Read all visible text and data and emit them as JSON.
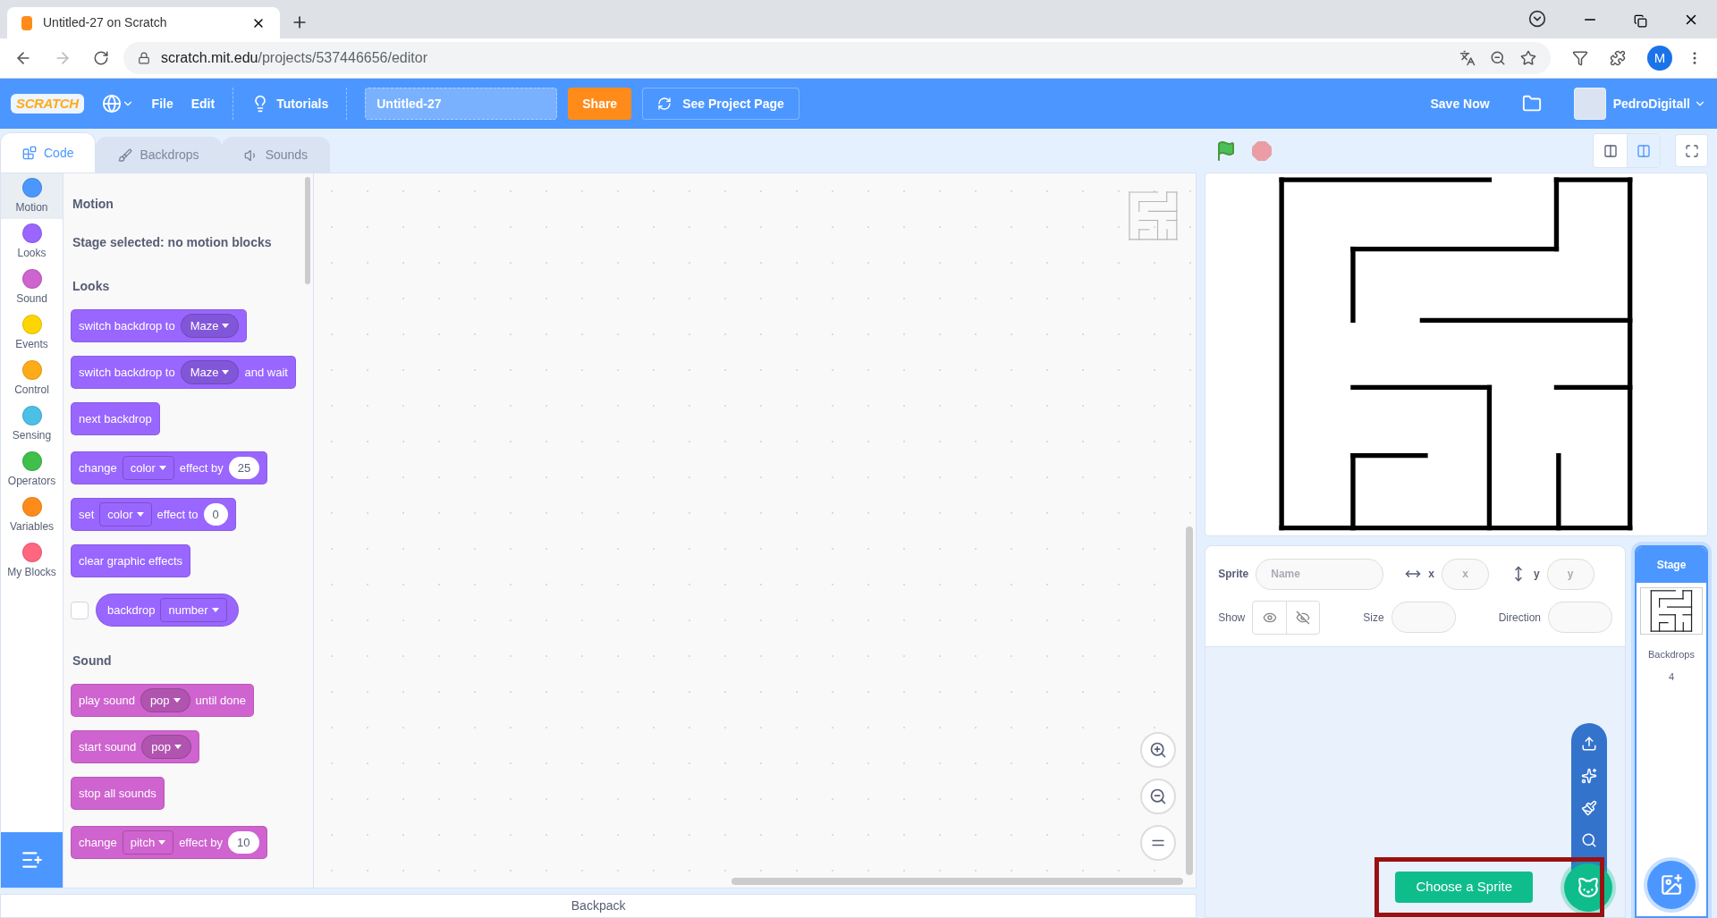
{
  "browser": {
    "tab_title": "Untitled-27 on Scratch",
    "url_host": "scratch.mit.edu",
    "url_path": "/projects/537446656/editor",
    "profile_letter": "M"
  },
  "menubar": {
    "logo": "SCRATCH",
    "items": [
      "File",
      "Edit"
    ],
    "tutorials": "Tutorials",
    "project_title": "Untitled-27",
    "share": "Share",
    "see_project": "See Project Page",
    "save_now": "Save Now",
    "username": "PedroDigitall"
  },
  "editor_tabs": [
    {
      "label": "Code",
      "selected": true
    },
    {
      "label": "Backdrops",
      "selected": false
    },
    {
      "label": "Sounds",
      "selected": false
    }
  ],
  "categories": [
    {
      "label": "Motion",
      "color": "#4c97ff",
      "selected": true
    },
    {
      "label": "Looks",
      "color": "#9966ff",
      "selected": false
    },
    {
      "label": "Sound",
      "color": "#cf63cf",
      "selected": false
    },
    {
      "label": "Events",
      "color": "#ffd500",
      "selected": false
    },
    {
      "label": "Control",
      "color": "#ffab19",
      "selected": false
    },
    {
      "label": "Sensing",
      "color": "#4cbfe6",
      "selected": false
    },
    {
      "label": "Operators",
      "color": "#40bf4a",
      "selected": false
    },
    {
      "label": "Variables",
      "color": "#ff8c1a",
      "selected": false
    },
    {
      "label": "My Blocks",
      "color": "#ff6680",
      "selected": false
    }
  ],
  "palette": [
    {
      "title": "Motion",
      "note": "Stage selected: no motion blocks"
    },
    {
      "title": "Looks",
      "groups": [
        [
          {
            "kind": "stack",
            "color": "#9966ff",
            "parts": [
              {
                "kind": "text",
                "text": "switch backdrop to"
              },
              {
                "kind": "menu",
                "text": "Maze"
              }
            ]
          },
          {
            "kind": "stack",
            "color": "#9966ff",
            "parts": [
              {
                "kind": "text",
                "text": "switch backdrop to"
              },
              {
                "kind": "menu",
                "text": "Maze"
              },
              {
                "kind": "text",
                "text": "and wait"
              }
            ]
          },
          {
            "kind": "stack",
            "color": "#9966ff",
            "parts": [
              {
                "kind": "text",
                "text": "next backdrop"
              }
            ]
          }
        ],
        [
          {
            "kind": "stack",
            "color": "#9966ff",
            "parts": [
              {
                "kind": "text",
                "text": "change"
              },
              {
                "kind": "field",
                "text": "color"
              },
              {
                "kind": "text",
                "text": "effect by"
              },
              {
                "kind": "number",
                "text": "25"
              }
            ]
          },
          {
            "kind": "stack",
            "color": "#9966ff",
            "parts": [
              {
                "kind": "text",
                "text": "set"
              },
              {
                "kind": "field",
                "text": "color"
              },
              {
                "kind": "text",
                "text": "effect to"
              },
              {
                "kind": "number",
                "text": "0"
              }
            ]
          },
          {
            "kind": "stack",
            "color": "#9966ff",
            "parts": [
              {
                "kind": "text",
                "text": "clear graphic effects"
              }
            ]
          }
        ],
        [
          {
            "kind": "reporter",
            "color": "#9966ff",
            "checked": false,
            "parts": [
              {
                "kind": "text",
                "text": "backdrop"
              },
              {
                "kind": "field",
                "text": "number"
              }
            ]
          }
        ]
      ]
    },
    {
      "title": "Sound",
      "groups": [
        [
          {
            "kind": "stack",
            "color": "#cf63cf",
            "parts": [
              {
                "kind": "text",
                "text": "play sound"
              },
              {
                "kind": "menu",
                "text": "pop"
              },
              {
                "kind": "text",
                "text": "until done"
              }
            ]
          },
          {
            "kind": "stack",
            "color": "#cf63cf",
            "parts": [
              {
                "kind": "text",
                "text": "start sound"
              },
              {
                "kind": "menu",
                "text": "pop"
              }
            ]
          },
          {
            "kind": "stack",
            "color": "#cf63cf",
            "parts": [
              {
                "kind": "text",
                "text": "stop all sounds"
              }
            ]
          }
        ],
        [
          {
            "kind": "stack",
            "color": "#cf63cf",
            "parts": [
              {
                "kind": "text",
                "text": "change"
              },
              {
                "kind": "field",
                "text": "pitch"
              },
              {
                "kind": "text",
                "text": "effect by"
              },
              {
                "kind": "number",
                "text": "10"
              }
            ]
          }
        ]
      ]
    }
  ],
  "sprite_info": {
    "sprite_label": "Sprite",
    "name_placeholder": "Name",
    "x_label": "x",
    "x_placeholder": "x",
    "y_label": "y",
    "y_placeholder": "y",
    "show_label": "Show",
    "size_label": "Size",
    "direction_label": "Direction"
  },
  "stage_selector": {
    "title": "Stage",
    "label": "Backdrops",
    "count": "4"
  },
  "sprite_menu": {
    "tooltip": "Choose a Sprite"
  },
  "backpack": "Backpack"
}
